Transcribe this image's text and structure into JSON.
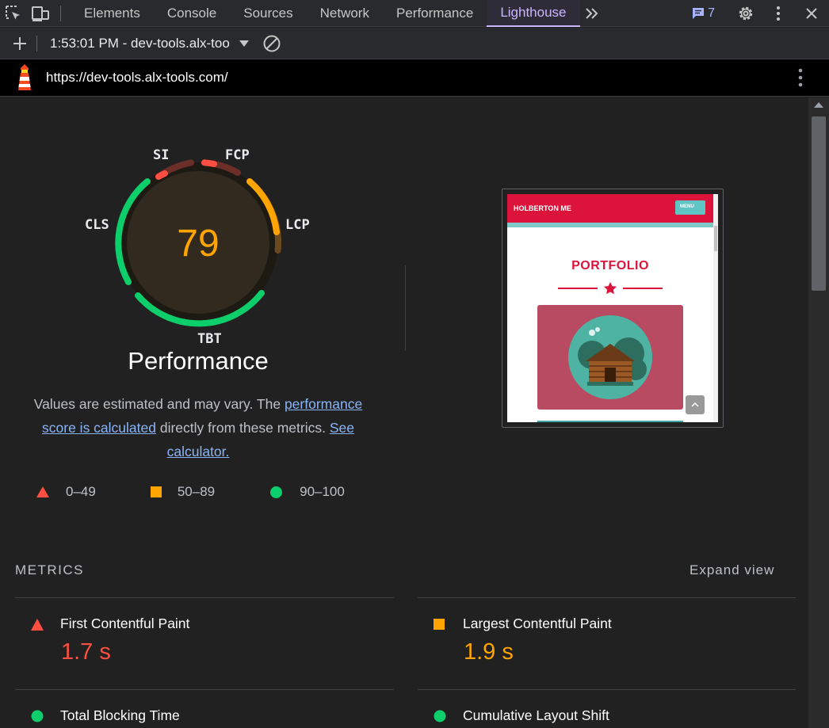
{
  "devtools": {
    "tabs": [
      "Elements",
      "Console",
      "Sources",
      "Network",
      "Performance",
      "Lighthouse"
    ],
    "active_tab": "Lighthouse",
    "more_tabs_icon": ">>",
    "issues_count": "7"
  },
  "toolbar": {
    "report_label": "1:53:01 PM - dev-tools.alx-too"
  },
  "report": {
    "url": "https://dev-tools.alx-tools.com/"
  },
  "gauge": {
    "score": "79",
    "score_value": 79,
    "labels": {
      "si": "SI",
      "fcp": "FCP",
      "lcp": "LCP",
      "cls": "CLS",
      "tbt": "TBT"
    },
    "colors": {
      "fail": "#ff4e42",
      "average": "#ffa400",
      "pass": "#0cce6b",
      "score_text": "#ffa400"
    }
  },
  "performance": {
    "title": "Performance",
    "desc_prefix": "Values are estimated and may vary. The ",
    "desc_link1": "performance score is calculated",
    "desc_middle": " directly from these metrics. ",
    "desc_link2": "See calculator."
  },
  "legend": {
    "fail": "0–49",
    "average": "50–89",
    "pass": "90–100"
  },
  "screenshot": {
    "header_text": "HOLBERTON ME",
    "menu_text": "MENU",
    "heading": "PORTFOLIO"
  },
  "metrics": {
    "heading": "METRICS",
    "expand_label": "Expand view",
    "items": [
      {
        "name": "First Contentful Paint",
        "value": "1.7 s",
        "rating": "fail"
      },
      {
        "name": "Largest Contentful Paint",
        "value": "1.9 s",
        "rating": "average"
      },
      {
        "name": "Total Blocking Time",
        "value": "",
        "rating": "pass"
      },
      {
        "name": "Cumulative Layout Shift",
        "value": "",
        "rating": "pass"
      }
    ]
  }
}
